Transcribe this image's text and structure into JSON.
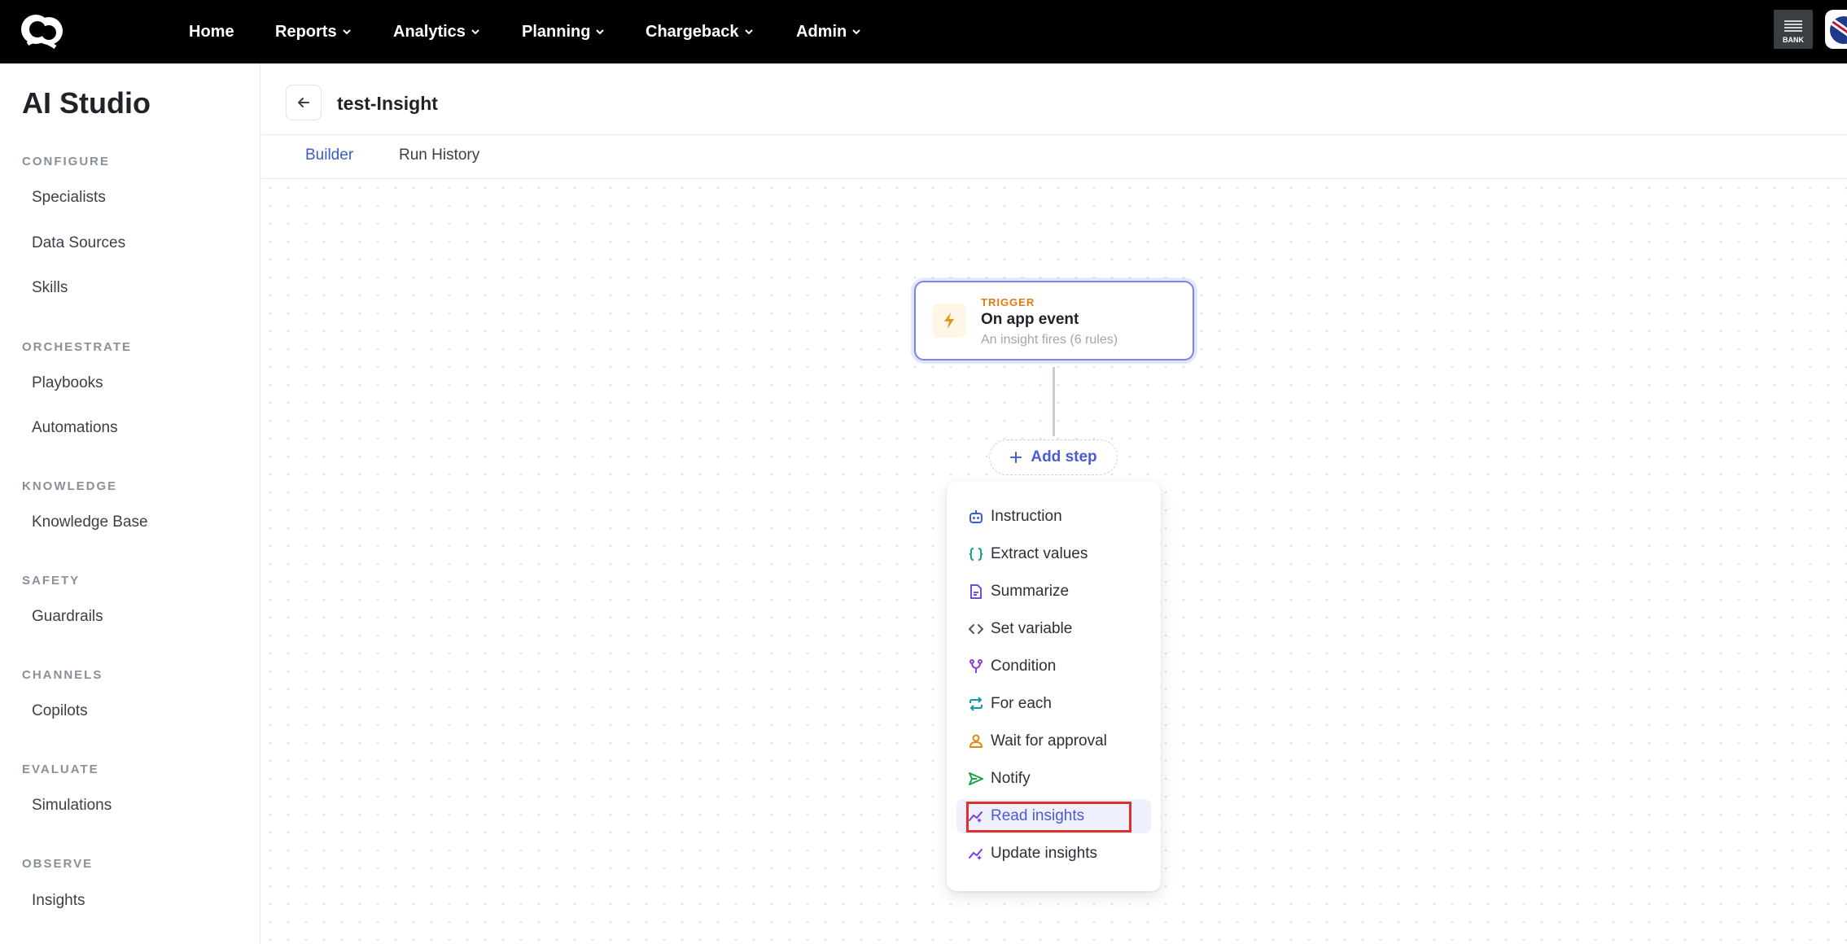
{
  "nav": {
    "items": [
      {
        "label": "Home",
        "has_menu": false
      },
      {
        "label": "Reports",
        "has_menu": true
      },
      {
        "label": "Analytics",
        "has_menu": true
      },
      {
        "label": "Planning",
        "has_menu": true
      },
      {
        "label": "Chargeback",
        "has_menu": true
      },
      {
        "label": "Admin",
        "has_menu": true
      }
    ],
    "bank_label": "BANK"
  },
  "sidebar": {
    "title": "AI Studio",
    "sections": [
      {
        "title": "CONFIGURE",
        "items": [
          "Specialists",
          "Data Sources",
          "Skills"
        ]
      },
      {
        "title": "ORCHESTRATE",
        "items": [
          "Playbooks",
          "Automations"
        ]
      },
      {
        "title": "KNOWLEDGE",
        "items": [
          "Knowledge Base"
        ]
      },
      {
        "title": "SAFETY",
        "items": [
          "Guardrails"
        ]
      },
      {
        "title": "CHANNELS",
        "items": [
          "Copilots"
        ]
      },
      {
        "title": "EVALUATE",
        "items": [
          "Simulations"
        ]
      },
      {
        "title": "OBSERVE",
        "items": [
          "Insights"
        ]
      }
    ]
  },
  "page": {
    "title": "test-Insight",
    "tabs": [
      {
        "label": "Builder",
        "active": true
      },
      {
        "label": "Run History",
        "active": false
      }
    ]
  },
  "trigger": {
    "kicker": "TRIGGER",
    "title": "On app event",
    "subtitle": "An insight fires (6 rules)",
    "icon": "bolt-icon"
  },
  "add_step": {
    "label": "Add step"
  },
  "step_menu": {
    "items": [
      {
        "label": "Instruction",
        "icon": "robot-icon",
        "color": "#3b5bdb"
      },
      {
        "label": "Extract values",
        "icon": "braces-icon",
        "color": "#12a38a"
      },
      {
        "label": "Summarize",
        "icon": "document-icon",
        "color": "#6d4fd8"
      },
      {
        "label": "Set variable",
        "icon": "code-icon",
        "color": "#4b5563"
      },
      {
        "label": "Condition",
        "icon": "branch-icon",
        "color": "#8b3fd9"
      },
      {
        "label": "For each",
        "icon": "repeat-icon",
        "color": "#0f9aa8"
      },
      {
        "label": "Wait for approval",
        "icon": "person-icon",
        "color": "#e08a12"
      },
      {
        "label": "Notify",
        "icon": "send-icon",
        "color": "#16a34a"
      },
      {
        "label": "Read insights",
        "icon": "insight-icon",
        "color": "#7c3aed",
        "selected": true
      },
      {
        "label": "Update insights",
        "icon": "insight-icon",
        "color": "#7c3aed"
      }
    ]
  },
  "colors": {
    "accent": "#4a5ccf",
    "trigger_border": "#7b83ee",
    "trigger_kicker": "#e07b12",
    "highlight_outline": "#e0302a"
  }
}
